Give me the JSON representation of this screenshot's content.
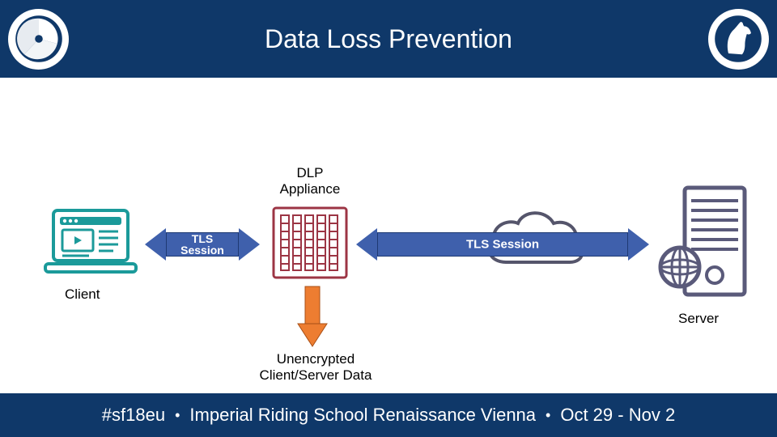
{
  "header": {
    "title": "Data Loss Prevention",
    "left_logo_name": "spinner-logo",
    "right_logo_name": "horse-logo"
  },
  "labels": {
    "dlp": "DLP\nAppliance",
    "tls_left": "TLS\nSession",
    "tls_right": "TLS Session",
    "client": "Client",
    "server": "Server",
    "unencrypted": "Unencrypted\nClient/Server Data"
  },
  "footer": {
    "hashtag": "#sf18eu",
    "sep": "•",
    "venue": "Imperial Riding School Renaissance Vienna",
    "dates": "Oct 29 - Nov 2"
  },
  "colors": {
    "header": "#0f3869",
    "arrow_blue": "#3f60ac",
    "arrow_orange": "#ed7d31",
    "appliance": "#9c3544",
    "client": "#1b9a9a",
    "server": "#5a5a7a"
  }
}
